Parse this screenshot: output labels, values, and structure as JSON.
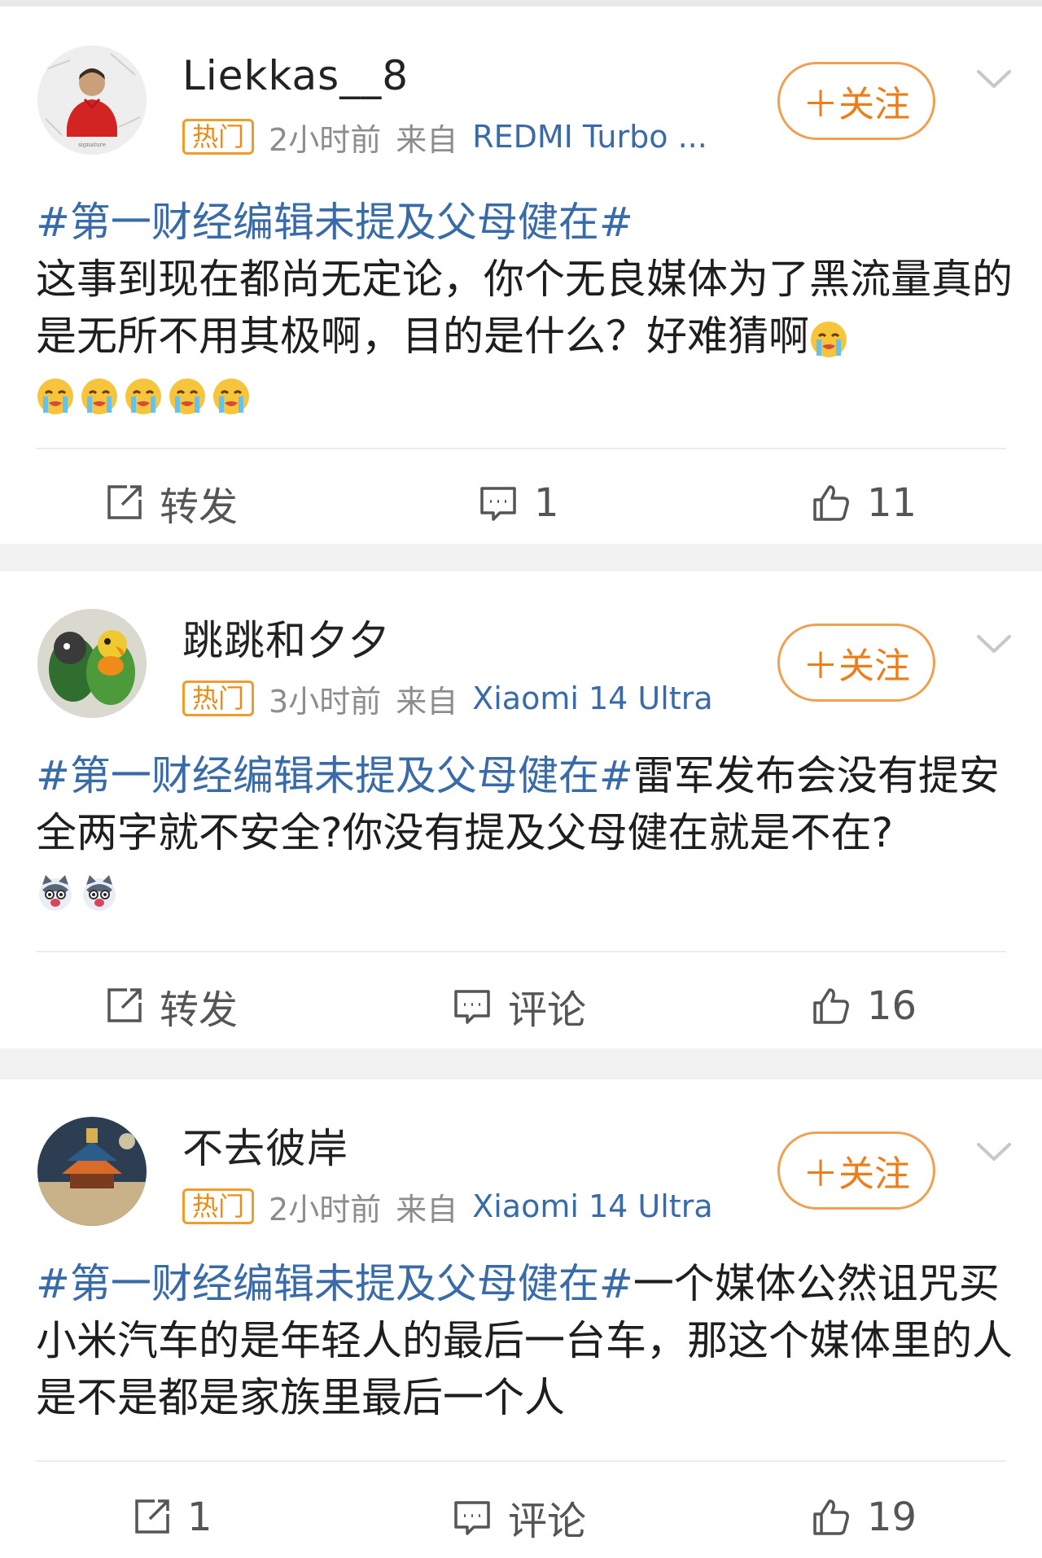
{
  "posts": [
    {
      "username": "Liekkas__8",
      "hot_label": "热门",
      "time": "2小时前",
      "source_prefix": "来自",
      "device": "REDMI Turbo ...",
      "follow_label": "＋关注",
      "hashtag": "#第一财经编辑未提及父母健在#",
      "text": "这事到现在都尚无定论，你个无良媒体为了黑流量真的是无所不用其极啊，目的是什么？好难猜啊",
      "emojis": [
        "crying-emoji",
        "crying-emoji",
        "crying-emoji",
        "crying-emoji",
        "crying-emoji",
        "crying-emoji"
      ],
      "repost_label": "转发",
      "comment_label": "1",
      "like_count": "11"
    },
    {
      "username": "跳跳和夕夕",
      "hot_label": "热门",
      "time": "3小时前",
      "source_prefix": "来自",
      "device": "Xiaomi 14 Ultra",
      "follow_label": "＋关注",
      "hashtag": "#第一财经编辑未提及父母健在#",
      "text": "雷军发布会没有提安全两字就不安全?你没有提及父母健在就是不在?",
      "emojis": [
        "husky-emoji",
        "husky-emoji"
      ],
      "repost_label": "转发",
      "comment_label": "评论",
      "like_count": "16"
    },
    {
      "username": "不去彼岸",
      "hot_label": "热门",
      "time": "2小时前",
      "source_prefix": "来自",
      "device": "Xiaomi 14 Ultra",
      "follow_label": "＋关注",
      "hashtag": "#第一财经编辑未提及父母健在#",
      "text": "一个媒体公然诅咒买小米汽车的是年轻人的最后一台车，那这个媒体里的人是不是都是家族里最后一个人",
      "emojis": [],
      "repost_label": "1",
      "comment_label": "评论",
      "like_count": "19"
    }
  ],
  "colors": {
    "accent_orange": "#ee7d17",
    "link_blue": "#386ba8",
    "meta_gray": "#8d8d8d"
  }
}
